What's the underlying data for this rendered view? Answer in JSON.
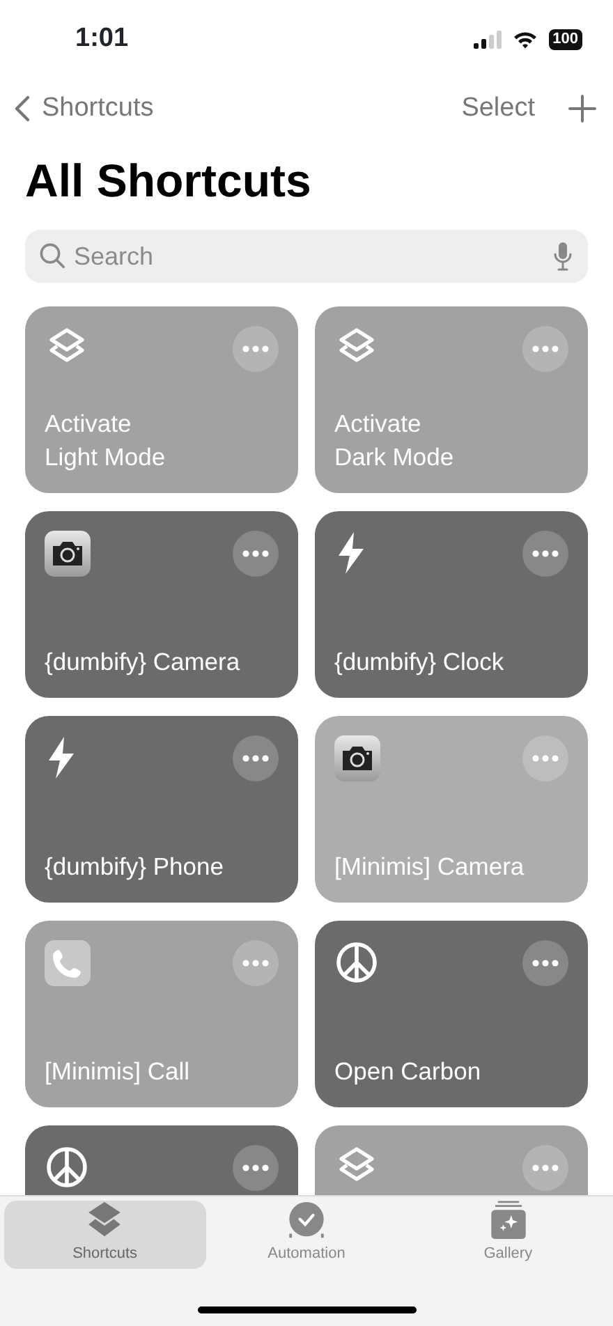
{
  "status_bar": {
    "time": "1:01",
    "battery": "100"
  },
  "nav": {
    "back": "Shortcuts",
    "select": "Select"
  },
  "title": "All Shortcuts",
  "search": {
    "placeholder": "Search"
  },
  "shortcuts": [
    {
      "name": "Activate\nLight Mode",
      "kind": "layers",
      "color": "#a2a2a2"
    },
    {
      "name": "Activate\nDark Mode",
      "kind": "layers",
      "color": "#a2a2a2"
    },
    {
      "name": "{dumbify} Camera",
      "kind": "camera",
      "color": "#6b6b6b"
    },
    {
      "name": "{dumbify} Clock",
      "kind": "bolt",
      "color": "#6b6b6b"
    },
    {
      "name": "{dumbify} Phone",
      "kind": "bolt",
      "color": "#6b6b6b"
    },
    {
      "name": "[Minimis] Camera",
      "kind": "camera",
      "color": "#adadad"
    },
    {
      "name": "[Minimis] Call",
      "kind": "phone",
      "color": "#a2a2a2"
    },
    {
      "name": "Open Carbon",
      "kind": "peace",
      "color": "#6b6b6b"
    },
    {
      "kind": "peace",
      "color": "#6b6b6b"
    },
    {
      "kind": "layers",
      "color": "#a2a2a2"
    }
  ],
  "tabs": [
    {
      "label": "Shortcuts",
      "selected": true
    },
    {
      "label": "Automation",
      "selected": false
    },
    {
      "label": "Gallery",
      "selected": false
    }
  ]
}
